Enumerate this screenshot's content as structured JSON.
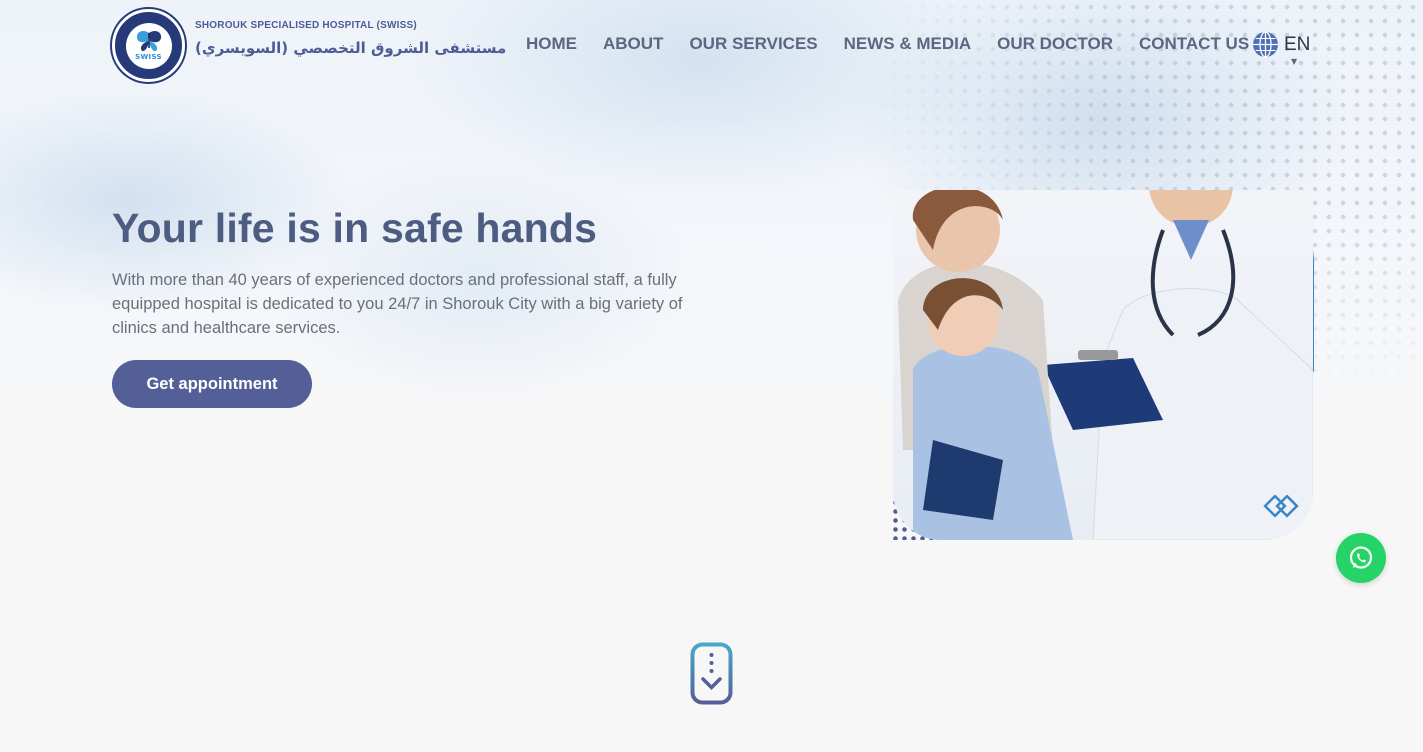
{
  "brand": {
    "name_en": "SHOROUK SPECIALISED HOSPITAL (SWISS)",
    "name_ar": "مستشفى الشروق التخصصي (السويسري)",
    "logo_text": "SWISS",
    "logo_icon": "butterfly-logo-icon"
  },
  "nav": {
    "items": [
      {
        "label": "HOME"
      },
      {
        "label": "ABOUT"
      },
      {
        "label": "OUR SERVICES"
      },
      {
        "label": "NEWS & MEDIA"
      },
      {
        "label": "OUR DOCTOR"
      },
      {
        "label": "CONTACT US"
      }
    ],
    "language": {
      "label": "EN",
      "icon": "globe-icon"
    }
  },
  "hero": {
    "title": "Your life is in safe hands",
    "subtitle": "With more than 40 years of experienced doctors and professional staff, a fully equipped hospital is dedicated to you 24/7 in Shorouk City with a big variety of clinics and healthcare services.",
    "cta_label": "Get appointment",
    "image_icon": "doctor-family-photo"
  },
  "floating": {
    "whatsapp_icon": "whatsapp-icon"
  },
  "scroll_icon": "scroll-down-icon",
  "colors": {
    "primary": "#545f98",
    "title": "#4d5d82",
    "accent_blue": "#3a87c6",
    "whatsapp": "#25d366"
  }
}
